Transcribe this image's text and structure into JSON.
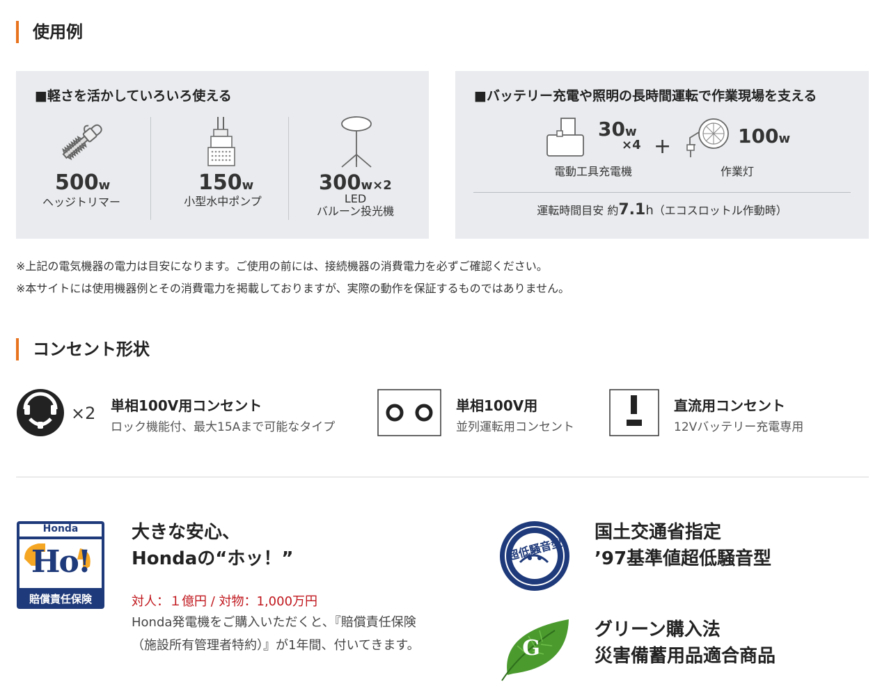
{
  "sections": {
    "usage_title": "使用例",
    "outlet_title": "コンセント形状"
  },
  "usage_left": {
    "heading": "■軽さを活かしていろいろ使える",
    "items": [
      {
        "value": "500",
        "unit": "w",
        "label": "ヘッジトリマー",
        "icon": "hedge-trimmer-icon"
      },
      {
        "value": "150",
        "unit": "w",
        "label": "小型水中ポンプ",
        "icon": "pump-icon"
      },
      {
        "value": "300",
        "unit": "w×2",
        "label_line1": "LED",
        "label_line2": "バルーン投光機",
        "icon": "balloon-light-icon"
      }
    ]
  },
  "usage_right": {
    "heading": "■バッテリー充電や照明の長時間運転で作業現場を支える",
    "charger": {
      "value": "30",
      "unit": "w",
      "multiplier": "×4",
      "label": "電動工具充電機"
    },
    "plus": "+",
    "lamp": {
      "value": "100",
      "unit": "w",
      "label": "作業灯"
    },
    "runtime_prefix": "運転時間目安 約",
    "runtime_value": "7.1",
    "runtime_unit": "h",
    "runtime_suffix": "（エコスロットル作動時）"
  },
  "notes": [
    "※上記の電気機器の電力は目安になります。ご使用の前には、接続機器の消費電力を必ずご確認ください。",
    "※本サイトには使用機器例とその消費電力を掲載しておりますが、実際の動作を保証するものではありません。"
  ],
  "outlets": [
    {
      "multiplier": "×2",
      "title": "単相100V用コンセント",
      "sub": "ロック機能付、最大15Aまで可能なタイプ"
    },
    {
      "title": "単相100V用",
      "sub": "並列運転用コンセント"
    },
    {
      "title": "直流用コンセント",
      "sub": "12Vバッテリー充電専用"
    }
  ],
  "insurance": {
    "badge_top": "Honda",
    "badge_mark": "Ho!",
    "badge_bottom": "賠償責任保険",
    "title_line1": "大きな安心、",
    "title_line2": "Hondaの“ホッ！”",
    "coverage": "対人：１億円 / 対物：1,000万円",
    "body": "Honda発電機をご購入いただくと、『賠償責任保険（施設所有管理者特約）』が1年間、付いてきます。"
  },
  "certs": [
    {
      "line1": "国土交通省指定",
      "line2": "’97基準値超低騒音型",
      "badge_text": "超低騒音型"
    },
    {
      "line1": "グリーン購入法",
      "line2": "災害備蓄用品適合商品",
      "badge_text": "G"
    }
  ],
  "colors": {
    "accent": "#e8731f",
    "panel": "#e9ebee",
    "red": "#c0161c",
    "navy": "#1f3a7a",
    "green": "#4a9a2e"
  }
}
